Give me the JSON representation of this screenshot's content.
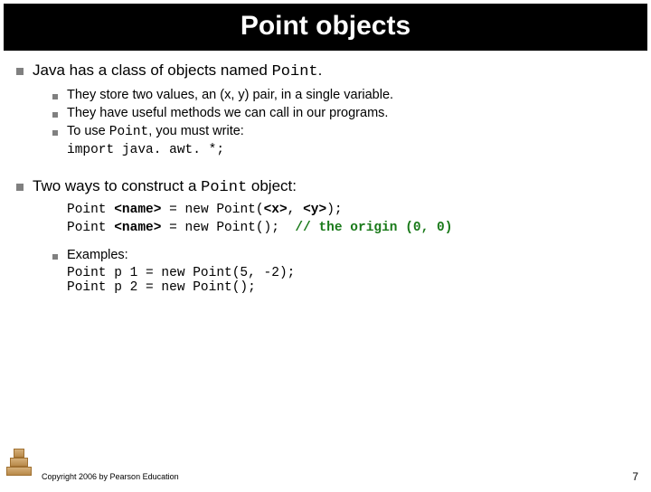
{
  "header": {
    "title": "Point objects"
  },
  "body": {
    "p1": {
      "pre": "Java has a class of objects named ",
      "code": "Point",
      "post": ".",
      "sub": {
        "a": "They store two values, an (x, y) pair, in a single variable.",
        "b": "They have useful methods we can call in our programs.",
        "c_pre": "To use ",
        "c_code": "Point",
        "c_post": ", you must write:",
        "c_import": "import java. awt. *;"
      }
    },
    "p2": {
      "pre": "Two ways to construct a ",
      "code": "Point",
      "post": " object:",
      "code1_a": "Point ",
      "code1_b": "<name>",
      "code1_c": " = new Point(",
      "code1_d": "<x>",
      "code1_e": ", ",
      "code1_f": "<y>",
      "code1_g": ");",
      "code2_a": "Point ",
      "code2_b": "<name>",
      "code2_c": " = new Point();  ",
      "code2_comment": "// the origin (0, 0)",
      "examples_label": "Examples:",
      "ex1": "Point p 1 = new Point(5, -2);",
      "ex2": "Point p 2 = new Point();"
    }
  },
  "footer": {
    "copyright": "Copyright 2006 by Pearson Education",
    "page": "7"
  }
}
